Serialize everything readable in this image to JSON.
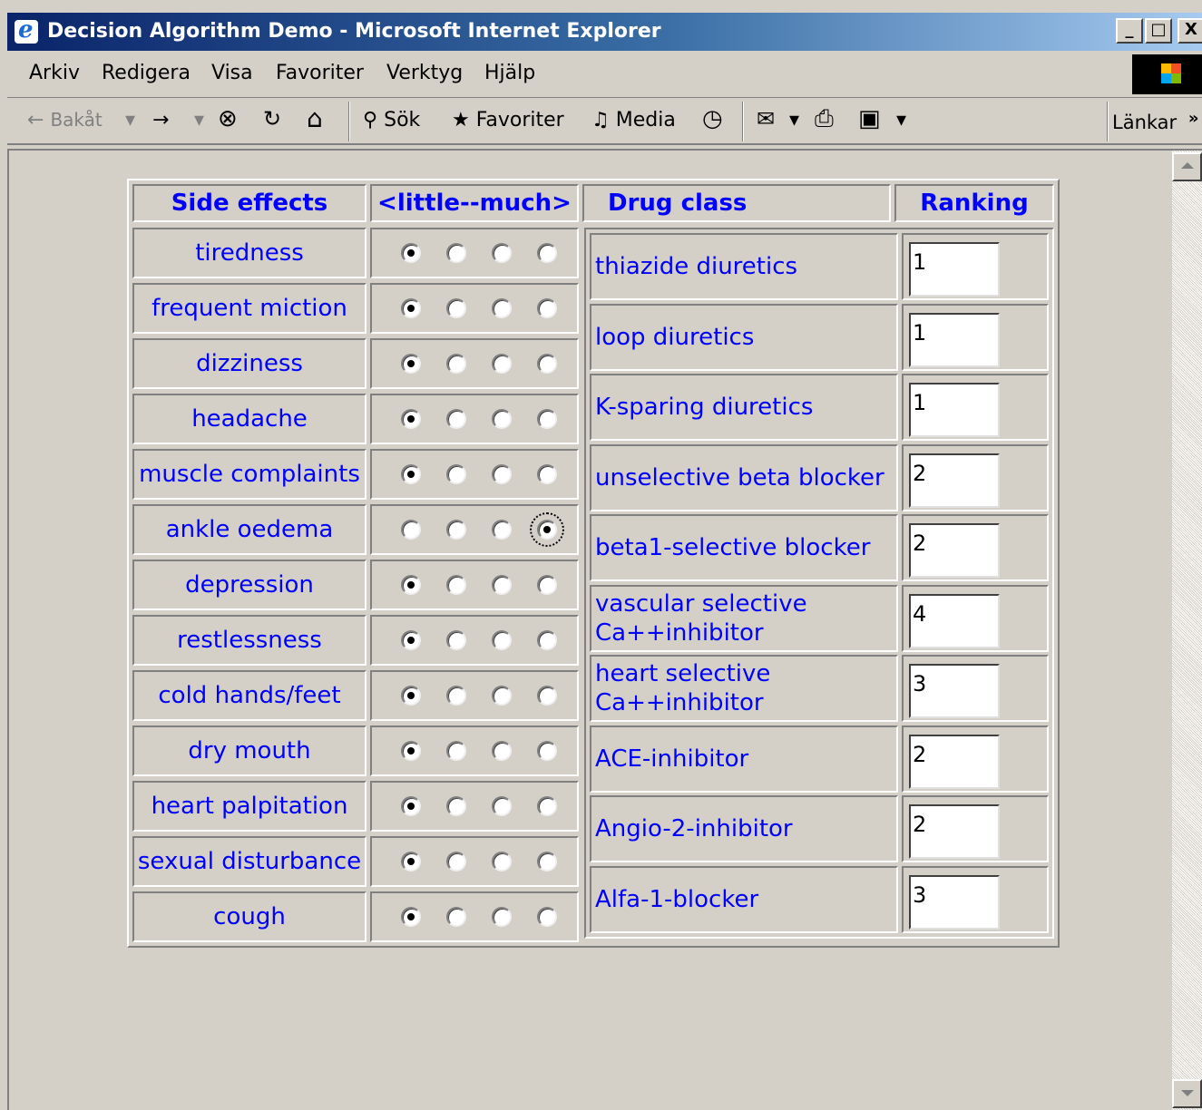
{
  "window": {
    "title": "Decision Algorithm Demo - Microsoft Internet Explorer",
    "min": "_",
    "max": "□",
    "close": "X"
  },
  "menu": [
    {
      "label": "Arkiv"
    },
    {
      "label": "Redigera"
    },
    {
      "label": "Visa"
    },
    {
      "label": "Favoriter"
    },
    {
      "label": "Verktyg"
    },
    {
      "label": "Hjälp"
    }
  ],
  "toolbar": {
    "back": "Bakåt",
    "back_icon": "←",
    "forward_icon": "→",
    "dropdown_icon": "▾",
    "stop_icon": "⊗",
    "refresh_icon": "↻",
    "home_icon": "⌂",
    "search": "Sök",
    "search_icon": "⚲",
    "favorites": "Favoriter",
    "favorites_icon": "★",
    "media": "Media",
    "media_icon": "♫",
    "history_icon": "◷",
    "mail_icon": "✉",
    "print_icon": "⎙",
    "edit_icon": "▣",
    "links": "Länkar",
    "links_chevron": "»"
  },
  "table": {
    "headers": {
      "side_effects": "Side effects",
      "scale": "<little--much>",
      "drug_class": "Drug class",
      "ranking": "Ranking"
    },
    "side_effects": [
      {
        "label": "tiredness",
        "selected": 0
      },
      {
        "label": "frequent miction",
        "selected": 0
      },
      {
        "label": "dizziness",
        "selected": 0
      },
      {
        "label": "headache",
        "selected": 0
      },
      {
        "label": "muscle complaints",
        "selected": 0
      },
      {
        "label": "ankle oedema",
        "selected": 3
      },
      {
        "label": "depression",
        "selected": 0
      },
      {
        "label": "restlessness",
        "selected": 0
      },
      {
        "label": "cold hands/feet",
        "selected": 0
      },
      {
        "label": "dry mouth",
        "selected": 0
      },
      {
        "label": "heart palpitation",
        "selected": 0
      },
      {
        "label": "sexual disturbance",
        "selected": 0
      },
      {
        "label": "cough",
        "selected": 0
      }
    ],
    "drugs": [
      {
        "label": "thiazide diuretics",
        "rank": "1"
      },
      {
        "label": "loop diuretics",
        "rank": "1"
      },
      {
        "label": "K-sparing diuretics",
        "rank": "1"
      },
      {
        "label": "unselective beta blocker",
        "rank": "2"
      },
      {
        "label": "beta1-selective blocker",
        "rank": "2"
      },
      {
        "label": "vascular selective Ca++inhibitor",
        "rank": "4"
      },
      {
        "label": "heart selective Ca++inhibitor",
        "rank": "3"
      },
      {
        "label": "ACE-inhibitor",
        "rank": "2"
      },
      {
        "label": "Angio-2-inhibitor",
        "rank": "2"
      },
      {
        "label": "Alfa-1-blocker",
        "rank": "3"
      }
    ]
  }
}
